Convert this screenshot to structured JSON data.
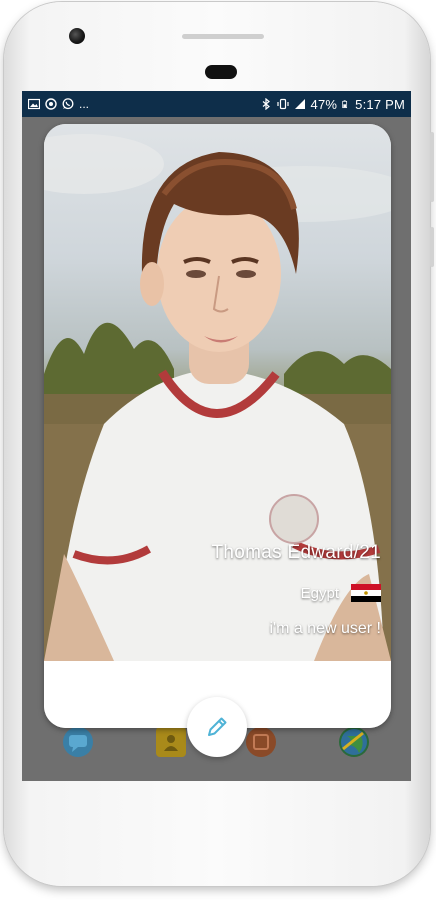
{
  "status_bar": {
    "notifications": [
      "image-icon",
      "settings-icon",
      "whatsapp-icon"
    ],
    "more": "...",
    "battery": "47%",
    "time": "5:17 PM"
  },
  "profile": {
    "name_age": "Thomas Edward/21",
    "country": "Egypt",
    "status": "i'm a new user !"
  },
  "colors": {
    "status_bar_bg": "#0e2e4a",
    "screen_dim": "#6f6f6f",
    "card_bg": "#ffffff",
    "fab_icon": "#4fb3d6"
  },
  "actions": {
    "edit_icon": "pencil-icon"
  },
  "background_nav": [
    "chat-icon",
    "contacts-icon",
    "profile-icon",
    "globe-icon"
  ]
}
